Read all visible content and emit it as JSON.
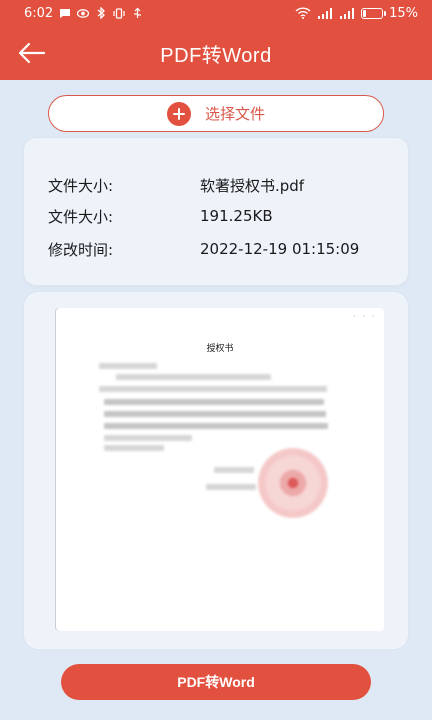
{
  "status_bar": {
    "time": "6:02",
    "battery": "15%",
    "icons": [
      "message-icon",
      "eye-icon",
      "bluetooth-icon",
      "vibrate-icon",
      "usb-icon",
      "wifi-icon",
      "signal-icon",
      "signal-icon-2",
      "battery-icon"
    ]
  },
  "app_bar": {
    "title": "PDF转Word",
    "back_icon": "arrow-left-icon"
  },
  "select_button": {
    "label": "选择文件",
    "icon": "plus-circle-icon"
  },
  "file_info": {
    "rows": [
      {
        "key": "文件大小:",
        "value": "软著授权书.pdf"
      },
      {
        "key": "文件大小:",
        "value": "191.25KB"
      },
      {
        "key": "修改时间:",
        "value": "2022-12-19 01:15:09"
      }
    ]
  },
  "preview": {
    "doc_title": "授权书"
  },
  "convert_button": {
    "label": "PDF转Word"
  },
  "colors": {
    "primary": "#e2513f",
    "background": "#dfe9f5",
    "card": "#eef3fa"
  }
}
